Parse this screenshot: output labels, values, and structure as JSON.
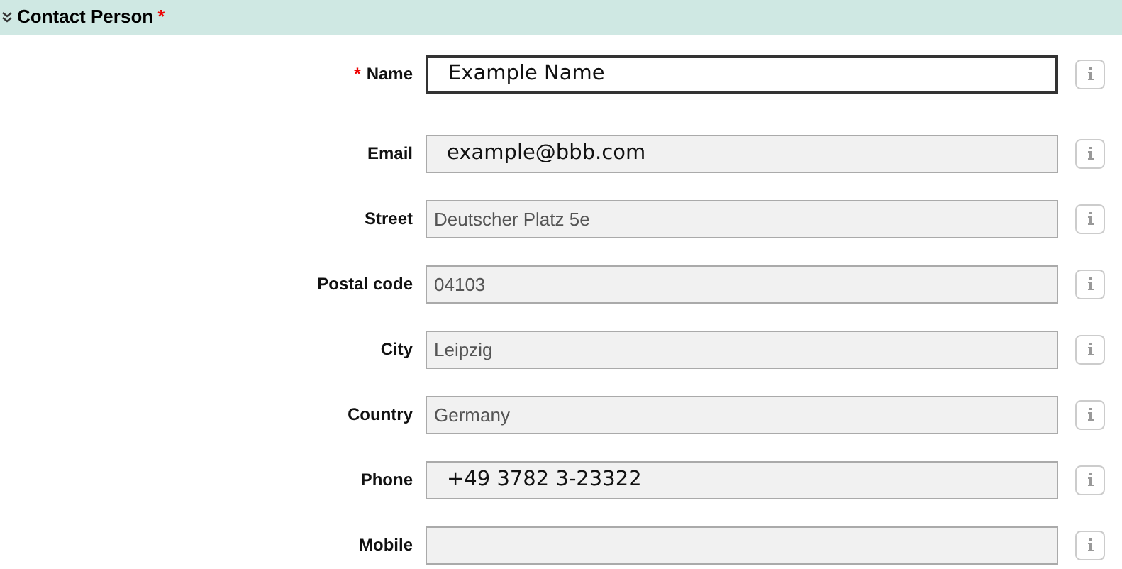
{
  "section": {
    "title": "Contact Person",
    "required_mark": "*",
    "expanded": true
  },
  "fields": [
    {
      "label": "Name",
      "value": "Example Name",
      "required_mark": "*",
      "editable": true,
      "kind": "large"
    },
    {
      "label": "Email",
      "value": "example@bbb.com",
      "editable": false,
      "kind": "large"
    },
    {
      "label": "Street",
      "value": "Deutscher Platz 5e",
      "editable": false,
      "kind": "plain"
    },
    {
      "label": "Postal code",
      "value": "04103",
      "editable": false,
      "kind": "plain"
    },
    {
      "label": "City",
      "value": "Leipzig",
      "editable": false,
      "kind": "plain"
    },
    {
      "label": "Country",
      "value": "Germany",
      "editable": false,
      "kind": "plain"
    },
    {
      "label": "Phone",
      "value": "+49 3782 3-23322",
      "editable": false,
      "kind": "large"
    },
    {
      "label": "Mobile",
      "editable": false,
      "kind": "plain"
    }
  ]
}
